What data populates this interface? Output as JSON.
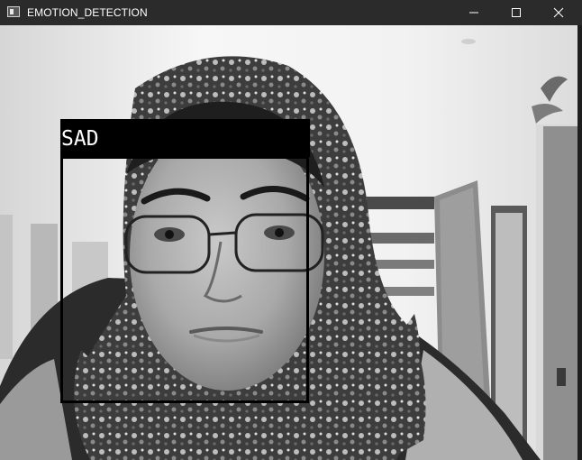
{
  "window": {
    "title": "EMOTION_DETECTION",
    "app_icon": "window-app-icon",
    "controls": {
      "minimize_icon": "minimize-icon",
      "maximize_icon": "maximize-icon",
      "close_icon": "close-icon"
    }
  },
  "detection": {
    "label": "SAD",
    "box_color": "#000000",
    "label_text_color": "#ffffff"
  },
  "colors": {
    "titlebar": "#2b2b2b",
    "title_text": "#ffffff"
  }
}
